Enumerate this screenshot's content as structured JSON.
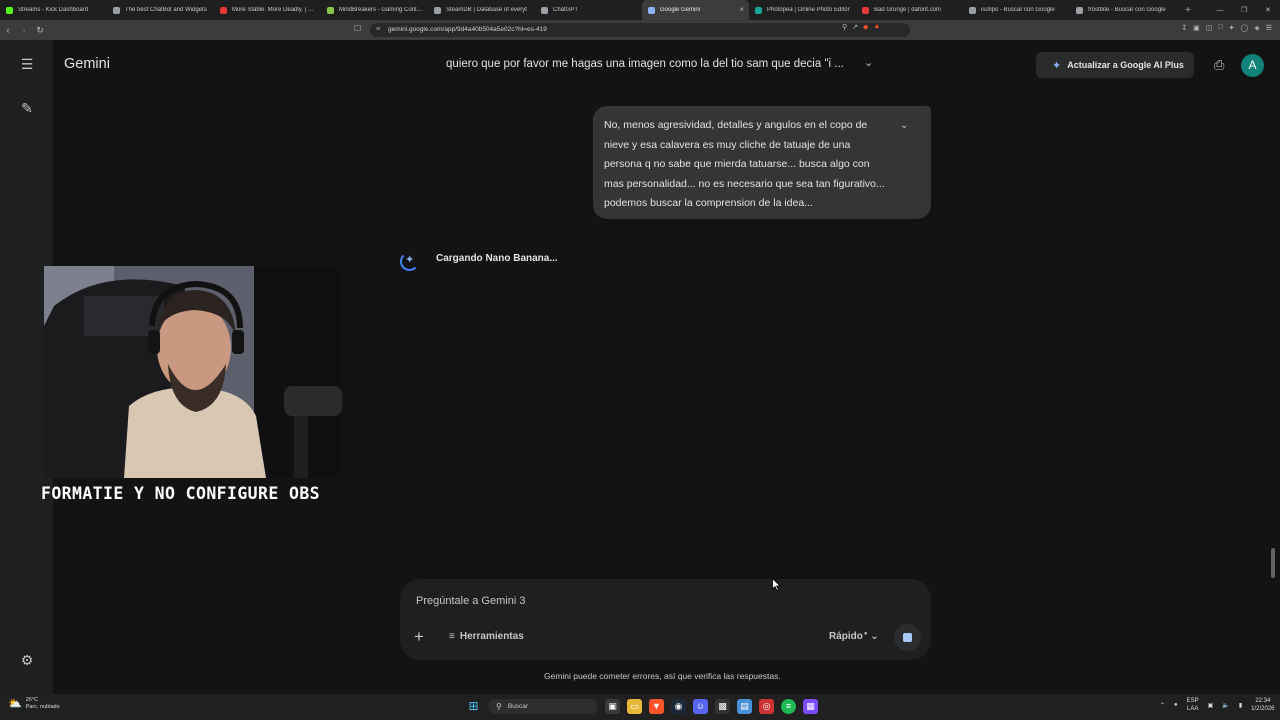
{
  "browser": {
    "tabs": [
      {
        "title": "Streams - Kick Dashboard",
        "color": "#53fc18"
      },
      {
        "title": "The best ChatBot and Widgets",
        "color": "#9aa0a6"
      },
      {
        "title": "More Stable. More Deadly. | 0...",
        "color": "#e53935"
      },
      {
        "title": "MindBreakers - Gaming Conten",
        "color": "#8bc34a"
      },
      {
        "title": "SteamDB | Database of everyt",
        "color": "#9aa0a6"
      },
      {
        "title": "ChatGPT",
        "color": "#9aa0a6"
      },
      {
        "title": "Google Gemini",
        "color": "#8ab4f8",
        "active": true
      },
      {
        "title": "Photopea | Online Photo Editor",
        "color": "#18a497"
      },
      {
        "title": "Bad Grunge | dafont.com",
        "color": "#e53935"
      },
      {
        "title": "isotipo - Buscar con Google",
        "color": "#9aa0a6"
      },
      {
        "title": "frostbite - Buscar con Google",
        "color": "#9aa0a6"
      }
    ],
    "new_tab": "+",
    "url": "gemini.google.com/app/9d4a40b504a5e02c?hl=es-419"
  },
  "gemini": {
    "app_title": "Gemini",
    "conversation_title": "quiero que por favor me hagas una imagen como la del tio sam que decia \"i ...",
    "upgrade_label": "Actualizar a Google AI Plus",
    "avatar_letter": "A",
    "user_message": "No, menos agresividad, detalles y angulos en el copo de nieve y esa calavera es muy cliche de tatuaje de una persona q no sabe que mierda tatuarse... busca algo con mas personalidad... no es necesario que sea tan figurativo... podemos buscar la comprension de la idea...",
    "loading_text": "Cargando Nano Banana...",
    "input_placeholder": "Pregúntale a Gemini 3",
    "tools_label": "Herramientas",
    "mode_label": "Rápido",
    "disclaimer": "Gemini puede cometer errores, así que verifica las respuestas."
  },
  "stream_overlay": {
    "text": "FORMATIE Y NO CONFIGURE OBS"
  },
  "taskbar": {
    "weather_temp": "26°C",
    "weather_desc": "Parc. nublado",
    "search_label": "Buscar",
    "lang_line1": "ESP",
    "lang_line2": "LAA",
    "time": "22:34",
    "date": "1/2/2026"
  }
}
